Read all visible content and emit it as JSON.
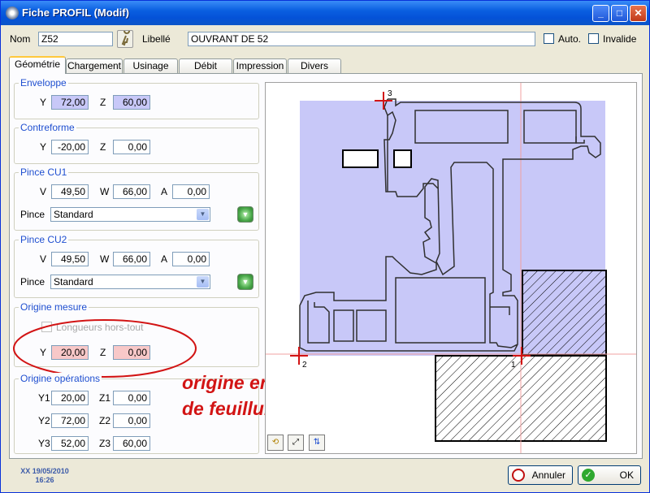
{
  "window": {
    "title": "Fiche PROFIL (Modif)"
  },
  "header": {
    "nom_label": "Nom",
    "nom_value": "Z52",
    "libelle_label": "Libellé",
    "libelle_value": "OUVRANT DE 52",
    "auto_label": "Auto.",
    "invalide_label": "Invalide"
  },
  "tabs": [
    "Géométrie",
    "Chargement",
    "Usinage",
    "Débit",
    "Impression",
    "Divers"
  ],
  "enveloppe": {
    "title": "Enveloppe",
    "y_label": "Y",
    "y_value": "72,00",
    "z_label": "Z",
    "z_value": "60,00"
  },
  "contreforme": {
    "title": "Contreforme",
    "y_label": "Y",
    "y_value": "-20,00",
    "z_label": "Z",
    "z_value": "0,00"
  },
  "pince_cu1": {
    "title": "Pince CU1",
    "v_label": "V",
    "v_value": "49,50",
    "w_label": "W",
    "w_value": "66,00",
    "a_label": "A",
    "a_value": "0,00",
    "pince_label": "Pince",
    "pince_value": "Standard"
  },
  "pince_cu2": {
    "title": "Pince CU2",
    "v_label": "V",
    "v_value": "49,50",
    "w_label": "W",
    "w_value": "66,00",
    "a_label": "A",
    "a_value": "0,00",
    "pince_label": "Pince",
    "pince_value": "Standard"
  },
  "origine_mesure": {
    "title": "Origine mesure",
    "longueurs_label": "Longueurs hors-tout",
    "y_label": "Y",
    "y_value": "20,00",
    "z_label": "Z",
    "z_value": "0,00"
  },
  "origine_operations": {
    "title": "Origine opérations",
    "rows": [
      {
        "y_label": "Y1",
        "y_value": "20,00",
        "z_label": "Z1",
        "z_value": "0,00"
      },
      {
        "y_label": "Y2",
        "y_value": "72,00",
        "z_label": "Z2",
        "z_value": "0,00"
      },
      {
        "y_label": "Y3",
        "y_value": "52,00",
        "z_label": "Z3",
        "z_value": "60,00"
      }
    ]
  },
  "annotation": {
    "line1": "origine en fond",
    "line2": "de feuillure"
  },
  "drawing": {
    "markers": [
      "3",
      "2",
      "1"
    ]
  },
  "footer": {
    "user_date": "XX 19/05/2010",
    "time": "16:26",
    "annuler_label": "Annuler",
    "ok_label": "OK"
  },
  "colors": {
    "envelope_fill": "#C8C8F8",
    "origin_pink": "#F8C8C8",
    "annotation_red": "#D21414",
    "title_blue": "#1F4FD0"
  }
}
